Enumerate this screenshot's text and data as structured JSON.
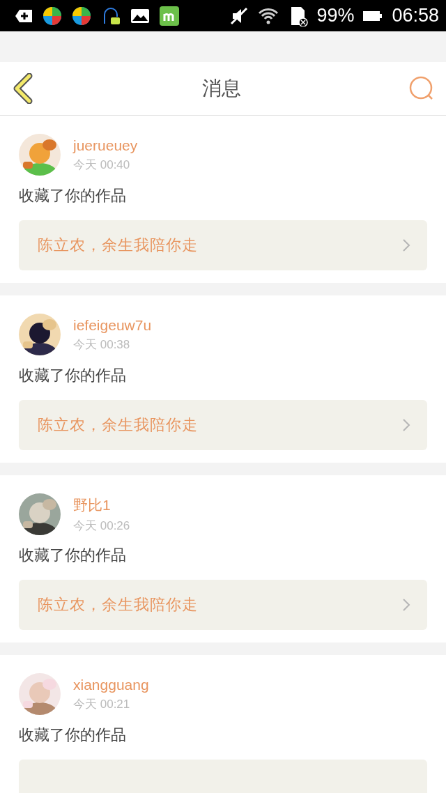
{
  "status_bar": {
    "battery": "99%",
    "time": "06:58"
  },
  "header": {
    "title": "消息"
  },
  "messages": [
    {
      "user": "juerueuey",
      "time": "今天 00:40",
      "action": "收藏了你的作品",
      "work": "陈立农，余生我陪你走"
    },
    {
      "user": "iefeigeuw7u",
      "time": "今天 00:38",
      "action": "收藏了你的作品",
      "work": "陈立农，余生我陪你走"
    },
    {
      "user": "野比1",
      "time": "今天 00:26",
      "action": "收藏了你的作品",
      "work": "陈立农，余生我陪你走"
    },
    {
      "user": "xiangguang",
      "time": "今天 00:21",
      "action": "收藏了你的作品"
    }
  ]
}
